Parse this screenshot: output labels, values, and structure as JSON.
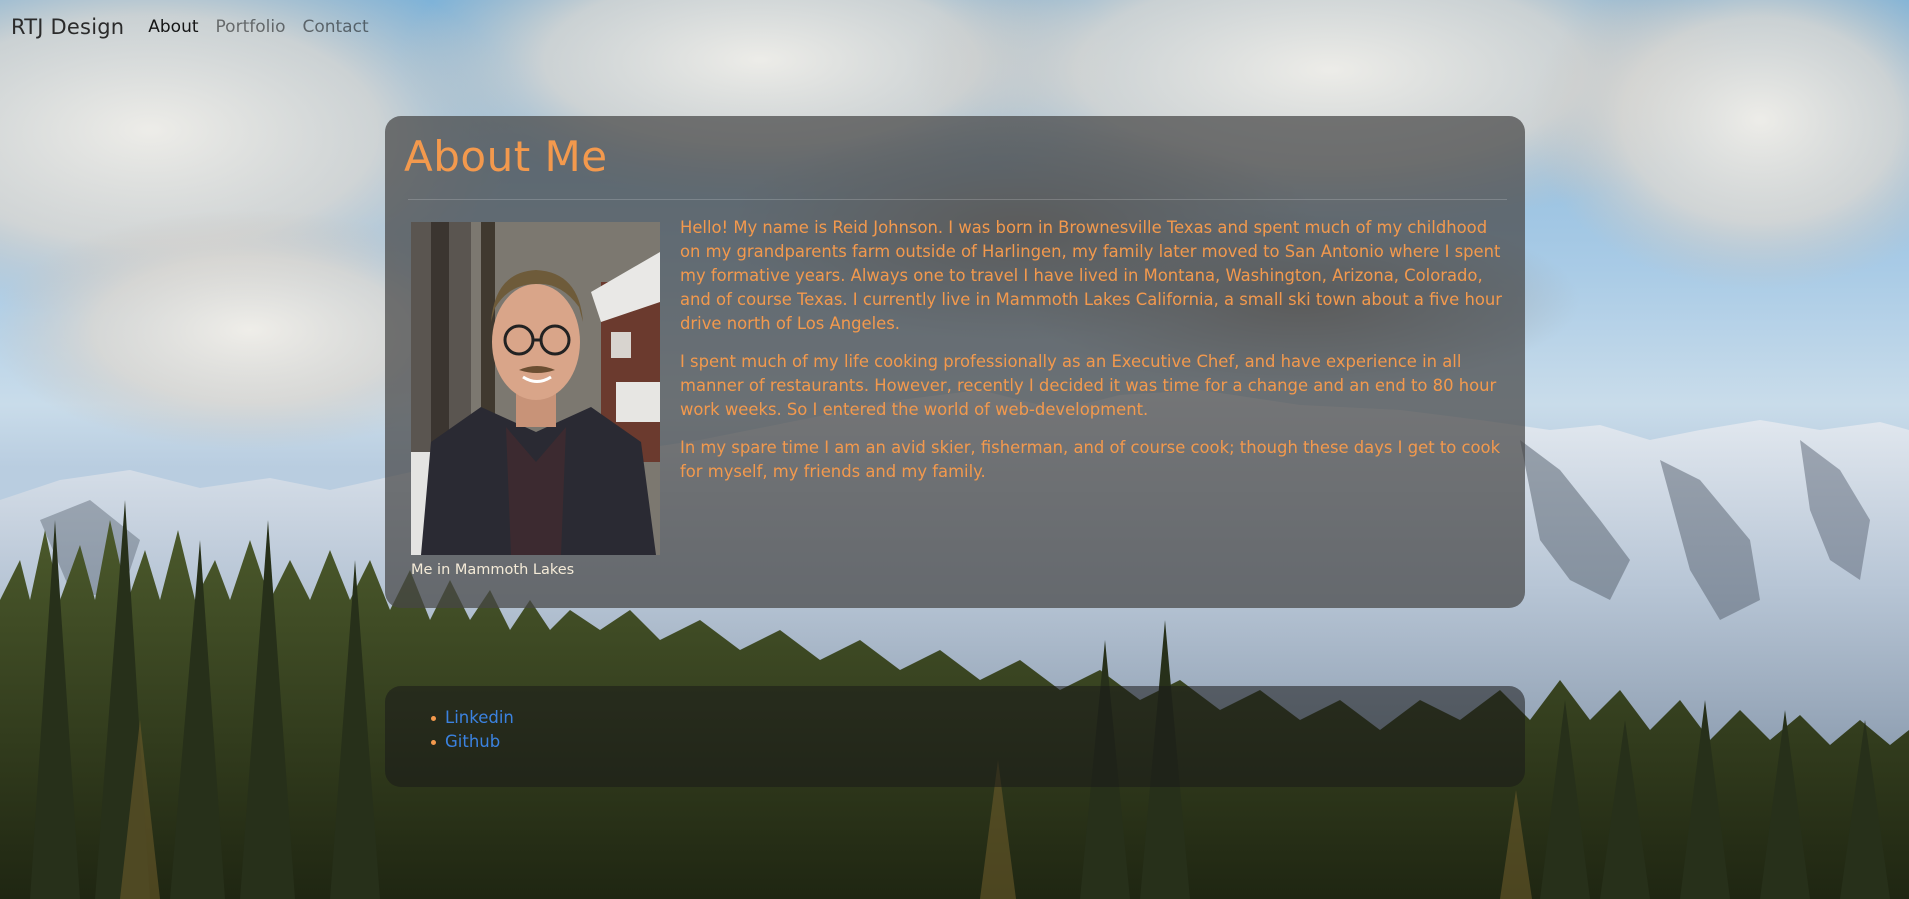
{
  "nav": {
    "brand": "RTJ Design",
    "links": [
      {
        "label": "About",
        "active": true
      },
      {
        "label": "Portfolio",
        "active": false
      },
      {
        "label": "Contact",
        "active": false
      }
    ]
  },
  "about": {
    "title": "About Me",
    "photo_caption": "Me in Mammoth Lakes",
    "paragraphs": [
      "Hello! My name is Reid Johnson. I was born in Brownesville Texas and spent much of my childhood on my grandparents farm outside of Harlingen, my family later moved to San Antonio where I spent my formative years. Always one to travel I have lived in Montana, Washington, Arizona, Colorado, and of course Texas. I currently live in Mammoth Lakes California, a small ski town about a five hour drive north of Los Angeles.",
      "I spent much of my life cooking professionally as an Executive Chef, and have experience in all manner of restaurants. However, recently I decided it was time for a change and an end to 80 hour work weeks. So I entered the world of web-development.",
      "In my spare time I am an avid skier, fisherman, and of course cook; though these days I get to cook for myself, my friends and my family."
    ]
  },
  "links": {
    "items": [
      {
        "label": "Linkedin"
      },
      {
        "label": "Github"
      }
    ]
  },
  "colors": {
    "accent_orange": "#f3994d",
    "link_blue": "#3b82e0",
    "card_bg": "rgba(70,70,70,0.72)"
  }
}
